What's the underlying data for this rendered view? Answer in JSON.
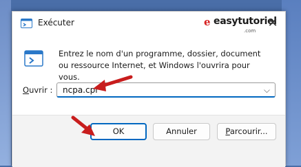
{
  "window": {
    "title": "Exécuter",
    "close_glyph": "✕"
  },
  "watermark": {
    "logo_glyph": "e",
    "text": "easytutoriel",
    "sub": ".com"
  },
  "body": {
    "description": "Entrez le nom d'un programme, dossier, document ou ressource Internet, et Windows l'ouvrira pour vous.",
    "open_label_prefix": "O",
    "open_label_rest": "uvrir :",
    "open_value": "ncpa.cpl",
    "dropdown_glyph": "⌵"
  },
  "buttons": {
    "ok": "OK",
    "cancel": "Annuler",
    "browse_prefix": "P",
    "browse_rest": "arcourir..."
  },
  "colors": {
    "accent": "#0067c0",
    "arrow": "#c81d1d"
  }
}
